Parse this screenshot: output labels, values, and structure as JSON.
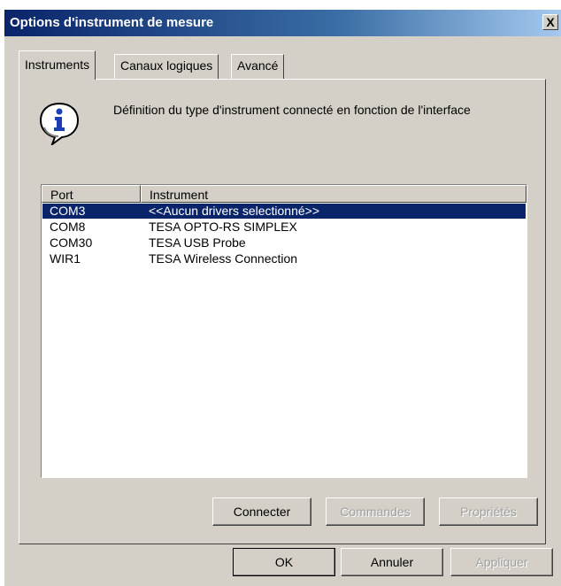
{
  "window": {
    "title": "Options d'instrument de mesure",
    "close_glyph": "X"
  },
  "tabs": [
    {
      "label": "Instruments",
      "active": true
    },
    {
      "label": "Canaux logiques",
      "active": false
    },
    {
      "label": "Avancé",
      "active": false
    }
  ],
  "panel": {
    "description": "Définition du type d'instrument connecté en fonction de l'interface",
    "icon": "info-icon"
  },
  "listview": {
    "columns": [
      "Port",
      "Instrument"
    ],
    "rows": [
      {
        "port": "COM3",
        "instrument": "<<Aucun drivers selectionné>>",
        "selected": true
      },
      {
        "port": "COM8",
        "instrument": "TESA OPTO-RS SIMPLEX",
        "selected": false
      },
      {
        "port": "COM30",
        "instrument": "TESA USB Probe",
        "selected": false
      },
      {
        "port": "WIR1",
        "instrument": "TESA Wireless Connection",
        "selected": false
      }
    ]
  },
  "panel_buttons": {
    "connect": "Connecter",
    "commands": "Commandes",
    "properties": "Propriétés"
  },
  "dialog_buttons": {
    "ok": "OK",
    "cancel": "Annuler",
    "apply": "Appliquer"
  },
  "colors": {
    "title_gradient_start": "#0a246a",
    "title_gradient_end": "#a6caf0",
    "selection": "#0a246a",
    "face": "#d4d0c8"
  }
}
